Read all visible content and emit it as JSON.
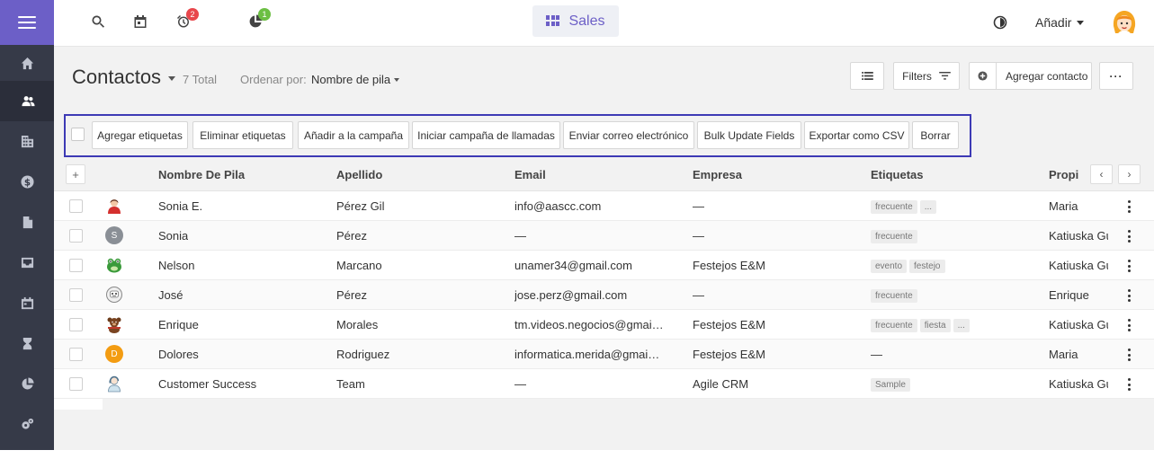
{
  "topbar": {
    "badge_reminders": "2",
    "badge_reports": "1",
    "module": "Sales",
    "add_menu": "Añadir"
  },
  "header": {
    "title": "Contactos",
    "total": "7 Total",
    "sort_label": "Ordenar por:",
    "sort_value": "Nombre de pila",
    "filters": "Filters",
    "add_contact": "Agregar contacto",
    "more": "···"
  },
  "bulk_actions": [
    "Agregar etiquetas",
    "Eliminar etiquetas",
    "Añadir a la campaña",
    "Iniciar campaña de llamadas",
    "Enviar correo electrónico",
    "Bulk Update Fields",
    "Exportar como CSV",
    "Borrar"
  ],
  "table": {
    "add_column": "+",
    "columns": [
      "Nombre De Pila",
      "Apellido",
      "Email",
      "Empresa",
      "Etiquetas",
      "Propi"
    ],
    "rows": [
      {
        "first": "Sonia E.",
        "last": "Pérez Gil",
        "email": "info@aascc.com",
        "company": "—",
        "tags": [
          "frecuente",
          "..."
        ],
        "owner": "Maria",
        "avatar": "woman-red-avatar"
      },
      {
        "first": "Sonia",
        "last": "Pérez",
        "email": "—",
        "company": "—",
        "tags": [
          "frecuente"
        ],
        "owner": "Katiuska Gu",
        "avatar": "letter-s-avatar",
        "initial": "S"
      },
      {
        "first": "Nelson",
        "last": "Marcano",
        "email": "unamer34@gmail.com",
        "company": "Festejos E&M",
        "tags": [
          "evento",
          "festejo"
        ],
        "owner": "Katiuska Gu",
        "avatar": "frog-avatar"
      },
      {
        "first": "José",
        "last": "Pérez",
        "email": "jose.perz@gmail.com",
        "company": "—",
        "tags": [
          "frecuente"
        ],
        "owner": "Enrique",
        "avatar": "robot-avatar"
      },
      {
        "first": "Enrique",
        "last": "Morales",
        "email": "tm.videos.negocios@gmai…",
        "company": "Festejos E&M",
        "tags": [
          "frecuente",
          "fiesta",
          "..."
        ],
        "owner": "Katiuska Gu",
        "avatar": "bear-avatar"
      },
      {
        "first": "Dolores",
        "last": "Rodriguez",
        "email": "informatica.merida@gmai…",
        "company": "Festejos E&M",
        "tags": [],
        "tags_empty": "—",
        "owner": "Maria",
        "avatar": "letter-d-avatar",
        "initial": "D"
      },
      {
        "first": "Customer Success",
        "last": "Team",
        "email": "—",
        "company": "Agile CRM",
        "tags": [
          "Sample"
        ],
        "owner": "Katiuska Gu",
        "avatar": "support-agent-avatar"
      }
    ]
  },
  "colors": {
    "accent": "#6c5fc7",
    "sidebar": "#363a48",
    "bulk_border": "#3d3ab5",
    "badge_red": "#e8474c",
    "badge_green": "#6cbf43"
  }
}
